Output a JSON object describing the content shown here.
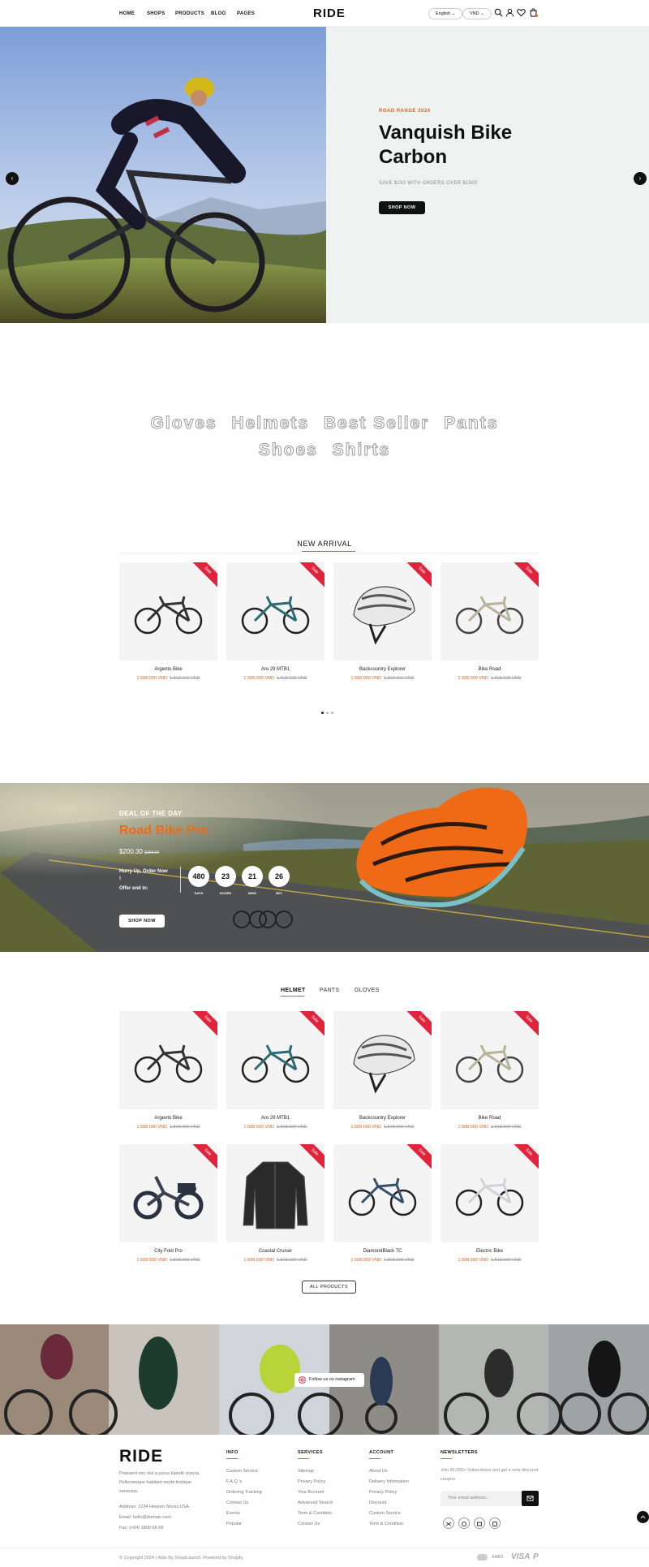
{
  "header": {
    "nav": [
      "HOME",
      "SHOPS",
      "PRODUCTS",
      "BLOG",
      "PAGES"
    ],
    "logo": "RIDE",
    "language": "English",
    "currency": "VND",
    "icons": [
      "search-icon",
      "user-icon",
      "heart-icon",
      "cart-icon"
    ]
  },
  "hero": {
    "eyebrow": "ROAD RANGE 2024",
    "title_line1": "Vanquish Bike",
    "title_line2": "Carbon",
    "subtitle": "SAVE $150 WITH ORDERS OVER $1500",
    "cta": "SHOP NOW",
    "prev_arrow": "‹",
    "next_arrow": "›"
  },
  "categories": {
    "row1": [
      "Gloves",
      "Helmets",
      "Best Seller",
      "Pants"
    ],
    "row2": [
      "Shoes",
      "Shirts"
    ]
  },
  "new_arrival": {
    "heading": "NEW ARRIVAL",
    "products": [
      {
        "name": "Argento Bike",
        "price": "1.508.000 VND",
        "old": "1.818.000 VND",
        "badge": "Sale",
        "kind": "bike-dark"
      },
      {
        "name": "Aro 29 MTB1",
        "price": "1.508.000 VND",
        "old": "1.818.000 VND",
        "badge": "Sale",
        "kind": "bike-teal"
      },
      {
        "name": "Backcountry Explorer",
        "price": "1.508.000 VND",
        "old": "1.818.000 VND",
        "badge": "Sale",
        "kind": "helmet"
      },
      {
        "name": "Bike Road",
        "price": "1.508.000 VND",
        "old": "1.818.000 VND",
        "badge": "Sale",
        "kind": "bike-light"
      }
    ]
  },
  "deal": {
    "eyebrow": "DEAL OF THE DAY",
    "title": "Road Bike Pro",
    "price": "$200.30",
    "old_price": "$250.00",
    "hurry": "Hurry Up, Order Now !",
    "offer": "Offer end in:",
    "countdown": [
      {
        "value": "480",
        "label": "DAYS"
      },
      {
        "value": "23",
        "label": "HOURS"
      },
      {
        "value": "21",
        "label": "MINS"
      },
      {
        "value": "26",
        "label": "SEC"
      }
    ],
    "cta": "SHOP NOW"
  },
  "tabs": {
    "items": [
      "HELMET",
      "PANTS",
      "GLOVES"
    ],
    "products": [
      {
        "name": "Argento Bike",
        "price": "1.508.000 VND",
        "old": "1.818.000 VND",
        "badge": "Sale",
        "kind": "bike-dark"
      },
      {
        "name": "Aro 29 MTB1",
        "price": "1.508.000 VND",
        "old": "1.818.000 VND",
        "badge": "Sale",
        "kind": "bike-teal"
      },
      {
        "name": "Backcountry Explorer",
        "price": "1.508.000 VND",
        "old": "1.818.000 VND",
        "badge": "Sale",
        "kind": "helmet"
      },
      {
        "name": "Bike Road",
        "price": "1.508.000 VND",
        "old": "1.818.000 VND",
        "badge": "Sale",
        "kind": "bike-light"
      },
      {
        "name": "City Fold Pro",
        "price": "1.508.000 VND",
        "old": "1.818.000 VND",
        "badge": "Sale",
        "kind": "ebike"
      },
      {
        "name": "Coastal Cruiser",
        "price": "1.508.000 VND",
        "old": "1.818.000 VND",
        "badge": "Sale",
        "kind": "jacket"
      },
      {
        "name": "DiamondBlack 7C",
        "price": "1.508.000 VND",
        "old": "1.818.000 VND",
        "badge": "Sale",
        "kind": "bike-blue"
      },
      {
        "name": "Electric Bike",
        "price": "1.508.000 VND",
        "old": "1.818.000 VND",
        "badge": "Sale",
        "kind": "bike-white"
      }
    ],
    "all_products": "ALL PRODUCTS"
  },
  "instagram": {
    "follow": "Follow us on instagram"
  },
  "footer": {
    "logo": "RIDE",
    "about": [
      "Praesent nec nisl a purus blandit viverra.",
      "Pellentesque habitant morbi tristique",
      "senectus."
    ],
    "address": "Address: 1234 Heaven Stress,USA.",
    "email": "Email: hello@domain.com",
    "fax": "Fax: (+84) 1800 68 68",
    "info": {
      "title": "INFO",
      "links": [
        "Custom Service",
        "F.A.Q.'s",
        "Ordering Tracking",
        "Contact Us",
        "Events",
        "Popular"
      ]
    },
    "services": {
      "title": "SERVICES",
      "links": [
        "Sitemap",
        "Privacy Policy",
        "Your Account",
        "Advanced Search",
        "Term & Condition",
        "Contact Us"
      ]
    },
    "account": {
      "title": "ACCOUNT",
      "links": [
        "About Us",
        "Delivery Information",
        "Privacy Policy",
        "Discount",
        "Custom Service",
        "Term & Condition"
      ]
    },
    "newsletter": {
      "title": "NEWSLETTERS",
      "text": "Join 60.000+ Subscribers and get a new discount coupon",
      "placeholder": "Your email address..."
    },
    "copyright": "© Copyright 2024 | Ride By ShopiLaunch. Powered by Shopify.",
    "payments": [
      "AMEX",
      "VISA",
      "P"
    ]
  }
}
